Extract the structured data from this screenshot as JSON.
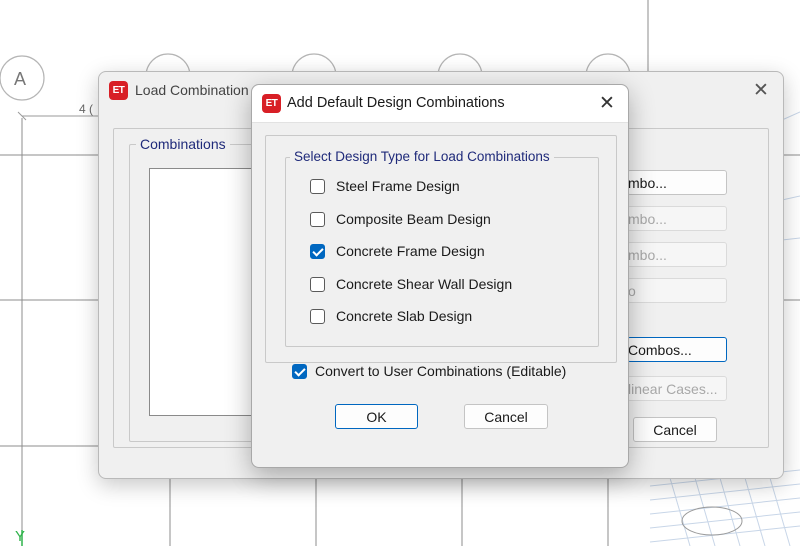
{
  "background": {
    "grid_bubble_label": "A",
    "dimension_label": "4 (",
    "axis_label": "Y"
  },
  "parent_dialog": {
    "title": "Load Combination",
    "close_symbol": "✕",
    "combinations_group_label": "Combinations",
    "right_buttons": [
      {
        "label": "mbo...",
        "enabled": true
      },
      {
        "label": "mbo...",
        "enabled": false
      },
      {
        "label": "mbo...",
        "enabled": false
      },
      {
        "label": "o",
        "enabled": false
      },
      {
        "label": "Combos...",
        "enabled": true
      },
      {
        "label": "linear Cases...",
        "enabled": false
      }
    ],
    "cancel_label": "Cancel"
  },
  "child_dialog": {
    "app_icon_text": "ET",
    "title": "Add Default Design Combinations",
    "close_symbol": "✕",
    "group_label": "Select Design Type for Load Combinations",
    "options": [
      {
        "label": "Steel Frame Design",
        "checked": false
      },
      {
        "label": "Composite Beam Design",
        "checked": false
      },
      {
        "label": "Concrete Frame Design",
        "checked": true
      },
      {
        "label": "Concrete Shear Wall Design",
        "checked": false
      },
      {
        "label": "Concrete Slab Design",
        "checked": false
      }
    ],
    "convert_label": "Convert to User Combinations (Editable)",
    "convert_checked": true,
    "ok_label": "OK",
    "cancel_label": "Cancel"
  },
  "colors": {
    "accent": "#0067c0",
    "app_icon": "#d81f26",
    "group_legend": "#1f2a7a",
    "axis_y": "#2fb24a"
  }
}
